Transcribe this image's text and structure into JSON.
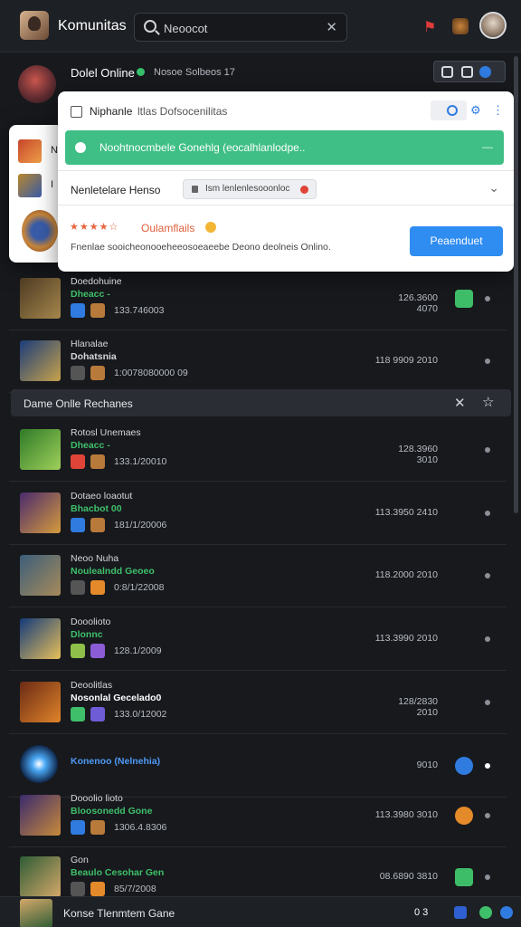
{
  "app": {
    "title": "Komunitas",
    "search_value": "Neoocot",
    "search_placeholder": "Neoocot"
  },
  "group": {
    "title": "Dolel Online",
    "members": "Nosoe Solbeos 17"
  },
  "popup": {
    "title": "Niphanle",
    "subtitle": "ltlas Dofsocenilitas",
    "banner_text": "Noohtnocmbele Gonehlg (eocalhlanlodpe..",
    "field_label": "Nenletelare Henso",
    "chip_text": "Ism lenlenlesooonloc",
    "rating_label": "Oulamflails",
    "stars": "★★★★☆",
    "description": "Fnenlae sooicheonooeheeosoeaeebe Deono deolneis Onlino.",
    "button_label": "Peaenduet"
  },
  "side": {
    "items": [
      {
        "label": "N",
        "color": "#c6452a"
      },
      {
        "label": "I",
        "color": "#b8862c"
      }
    ]
  },
  "rows_top": [
    {
      "name": "Doedohuine",
      "status": "Dheacc -",
      "status_color": "#3fbf6a",
      "date": "133.746003",
      "score": "126.3600 4070",
      "action_color": "#3ebd68",
      "chips": [
        "#2f7be0",
        "#b87a3a"
      ],
      "thumb": [
        "#4d3a22",
        "#a5864c"
      ]
    },
    {
      "name": "Hlanalae",
      "status": "Dohatsnia",
      "status_color": "#d4d7db",
      "date": "1:0078080000 09",
      "score": "118 9909 2010",
      "action_color": "",
      "chips": [
        "#555",
        "#b87a3a"
      ],
      "thumb": [
        "#1b3c7a",
        "#c7a24a"
      ]
    }
  ],
  "section": {
    "title": "Dame Onlle Rechanes"
  },
  "rows_bottom": [
    {
      "name": "Rotosl Unemaes",
      "status": "Dheacc -",
      "status_color": "#3fbf6a",
      "date": "133.1/20010",
      "score": "128.3960 3010",
      "chips": [
        "#e04438",
        "#b87a3a"
      ],
      "thumb": [
        "#2e7a28",
        "#9fd05a"
      ]
    },
    {
      "name": "Dotaeo loaotut",
      "status": "Bhacbot 00",
      "status_color": "#3fbf6a",
      "date": "181/1/20006",
      "score": "113.3950 2410",
      "chips": [
        "#2f7be0",
        "#b87a3a"
      ],
      "thumb": [
        "#4a2a6e",
        "#d69b3c"
      ]
    },
    {
      "name": "Neoo Nuha",
      "status": "Noulealndd Geoeo",
      "status_color": "#3fbf6a",
      "date": "0:8/1/22008",
      "score": "118.2000 2010",
      "chips": [
        "#555",
        "#e58a2a"
      ],
      "thumb": [
        "#3c5e7a",
        "#a68a5a"
      ]
    },
    {
      "name": "Dooolioto",
      "status": "Dlonnc",
      "status_color": "#3fbf6a",
      "date": "128.1/2009",
      "score": "113.3990 2010",
      "chips": [
        "#8ec04a",
        "#8c5cd6"
      ],
      "thumb": [
        "#123a7a",
        "#e8c05a"
      ]
    },
    {
      "name": "Deoolitlas",
      "status": "Nosonlal Gecelado0",
      "status_color": "#ffffff",
      "date": "133.0/12002",
      "score": "128/2830 2010",
      "chips": [
        "#3fbf6a",
        "#6e5cd6"
      ],
      "thumb": [
        "#6a2a14",
        "#e0842a"
      ]
    },
    {
      "name": "",
      "status": "Konenoo (Nelnehia)",
      "status_color": "#4f9af5",
      "date": "",
      "score": "9010",
      "action_color": "#2f7be0",
      "chips": [],
      "thumb": [
        "#0a1a3a",
        "#4aa8f5"
      ]
    },
    {
      "name": "Dooolio lioto",
      "status": "Bloosonedd Gone",
      "status_color": "#3fbf6a",
      "date": "1306.4.8306",
      "score": "113.3980 3010",
      "action_color": "#e58a2a",
      "chips": [
        "#2f7be0",
        "#b87a3a"
      ],
      "thumb": [
        "#3a2a6e",
        "#c88a3a"
      ]
    },
    {
      "name": "Gon",
      "status": "Beaulo Cesohar Gen",
      "status_color": "#3fbf6a",
      "date": "85/7/2008",
      "score": "08.6890 3810",
      "action_color": "#3ebd68",
      "chips": [
        "#555",
        "#e58a2a"
      ],
      "thumb": [
        "#2e5c35",
        "#d4a86a"
      ]
    }
  ],
  "bottom": {
    "title": "Konse Tlenmtem Gane",
    "info": "0 3"
  }
}
